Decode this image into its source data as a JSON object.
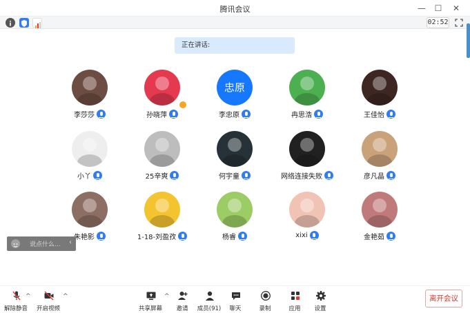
{
  "window": {
    "title": "腾讯会议",
    "minimize": "—",
    "maximize": "☐",
    "close": "✕"
  },
  "infobar": {
    "timer": "02:52"
  },
  "speaking": {
    "text": "正在讲话:"
  },
  "participants": [
    {
      "name": "李莎莎",
      "avatar": "photo-doll",
      "color": "#6d4c41"
    },
    {
      "name": "孙晓萍",
      "avatar": "photo-flower",
      "color": "#e53950"
    },
    {
      "name": "李忠原",
      "avatar": "text-avatar",
      "avatar_text": "忠原",
      "color": "#1677ff"
    },
    {
      "name": "冉思浩",
      "avatar": "photo-frog",
      "color": "#4caf50"
    },
    {
      "name": "王佳怡",
      "avatar": "photo-girl-dark",
      "color": "#3e2723"
    },
    {
      "name": "小丫",
      "avatar": "photo-rabbit",
      "color": "#eeeeee"
    },
    {
      "name": "25辛爽",
      "avatar": "photo-cat",
      "color": "#bdbdbd"
    },
    {
      "name": "何宇童",
      "avatar": "photo-cartoon",
      "color": "#263238"
    },
    {
      "name": "网络连接失败",
      "avatar": "photo-helmet",
      "color": "#212121"
    },
    {
      "name": "彦凡晶",
      "avatar": "photo-dog",
      "color": "#c9a27a"
    },
    {
      "name": "朱艳影",
      "avatar": "photo-child",
      "color": "#8d6e63"
    },
    {
      "name": "1-18-刘盈孜",
      "avatar": "photo-psyduck",
      "color": "#f4c430"
    },
    {
      "name": "杨睿",
      "avatar": "photo-anime",
      "color": "#9ccc65"
    },
    {
      "name": "xixi",
      "avatar": "photo-woman",
      "color": "#f1c3b5"
    },
    {
      "name": "金艳茹",
      "avatar": "photo-room",
      "color": "#c07a7a"
    }
  ],
  "chat": {
    "placeholder": "说点什么...",
    "chevron": "‹"
  },
  "toolbar": {
    "unmute": "解除静音",
    "start_video": "开启视频",
    "share_screen": "共享屏幕",
    "invite": "邀请",
    "members": "成员(91)",
    "chat": "聊天",
    "record": "录制",
    "apps": "应用",
    "settings": "设置",
    "leave": "离开会议"
  },
  "colors": {
    "accent": "#2f7cf6",
    "leave": "#d9362b",
    "speaking_bg": "#d9eafc"
  }
}
